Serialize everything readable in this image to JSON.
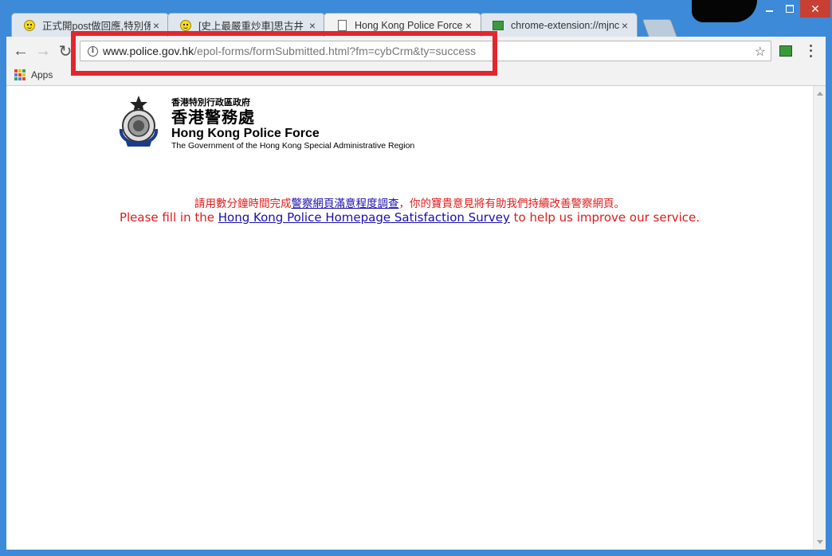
{
  "browser": {
    "tabs": [
      {
        "title": "正式開post做回應,特別係",
        "icon": "smiley-icon",
        "active": false
      },
      {
        "title": "[史上最嚴重炒車]思古井",
        "icon": "smiley-icon",
        "active": false
      },
      {
        "title": "Hong Kong Police Force",
        "icon": "page-icon",
        "active": true
      },
      {
        "title": "chrome-extension://mjnc",
        "icon": "image-icon",
        "active": false
      }
    ],
    "tab_close": "×",
    "address": {
      "host": "www.police.gov.hk",
      "path": "/epol-forms/formSubmitted.html?fm=cybCrm&ty=success"
    },
    "bookmarks": {
      "apps_label": "Apps"
    }
  },
  "page": {
    "header": {
      "gov_zh": "香港特別行政區政府",
      "force_zh": "香港警務處",
      "force_en": "Hong Kong Police Force",
      "gov_en": "The Government of the Hong Kong Special Administrative Region"
    },
    "survey_zh": {
      "before": "請用數分鐘時間完成",
      "link": "警察網頁滿意程度調查",
      "after": "，你的寶貴意見將有助我們持續改善警察網頁。"
    },
    "survey_en": {
      "before": "Please fill in the ",
      "link": "Hong Kong Police Homepage Satisfaction Survey",
      "after": " to help us improve our service."
    }
  },
  "colors": {
    "annotation": "#e3262d",
    "survey_text": "#e01b1b",
    "link": "#1a0dab",
    "window_frame": "#3c8ad8"
  }
}
